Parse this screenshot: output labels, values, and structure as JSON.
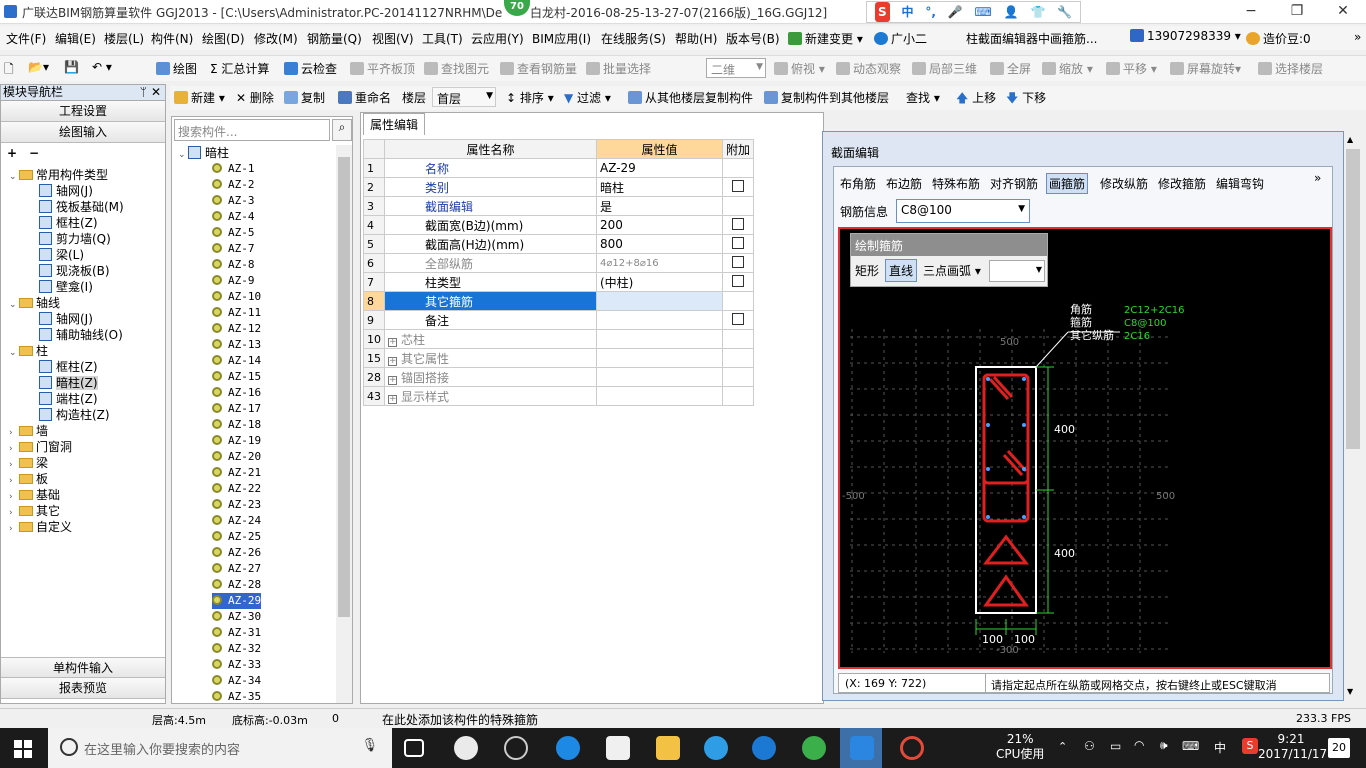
{
  "window": {
    "title": "广联达BIM钢筋算量软件 GGJ2013 - [C:\\Users\\Administrator.PC-20141127NRHM\\De",
    "title_tail": "白龙村-2016-08-25-13-27-07(2166版)_16G.GGJ12]",
    "badge": "70",
    "minimize": "−",
    "restore": "❐",
    "close": "✕"
  },
  "ime": {
    "s": "S",
    "zh": "中",
    "dot": "°,",
    "mic": "🎤",
    "kb": "⌨",
    "user": "👤",
    "shirt": "👕",
    "tool": "🔧"
  },
  "menu": [
    "文件(F)",
    "编辑(E)",
    "楼层(L)",
    "构件(N)",
    "绘图(D)",
    "修改(M)",
    "钢筋量(Q)",
    "视图(V)",
    "工具(T)",
    "云应用(Y)",
    "BIM应用(I)",
    "在线服务(S)",
    "帮助(H)",
    "版本号(B)",
    "新建变更",
    "广小二",
    "柱截面编辑器中画箍筋..."
  ],
  "phone": "13907298339",
  "price": "造价豆:0",
  "toolbar1": {
    "draw": "绘图",
    "sum": "汇总计算",
    "cloud": "云检查",
    "flat": "平齐板顶",
    "find_elem": "查找图元",
    "view_qty": "查看钢筋量",
    "batch": "批量选择",
    "view_mode": "二维",
    "top_view": "俯视",
    "dyn": "动态观察",
    "local3d": "局部三维",
    "fullscreen": "全屏",
    "zoom": "缩放",
    "pan": "平移",
    "rotate": "屏幕旋转",
    "select_floor": "选择楼层"
  },
  "toolbar2": {
    "new": "新建",
    "delete": "删除",
    "copy": "复制",
    "rename": "重命名",
    "floor_label": "楼层",
    "floor_value": "首层",
    "sort": "排序",
    "filter": "过滤",
    "copy_from": "从其他楼层复制构件",
    "copy_to": "复制构件到其他楼层",
    "find": "查找",
    "up": "上移",
    "down": "下移"
  },
  "nav": {
    "header": "模块导航栏",
    "pin": "ᛘ",
    "close": "✕",
    "btn1": "工程设置",
    "btn2": "绘图输入",
    "btn3": "单构件输入",
    "btn4": "报表预览",
    "tree": [
      {
        "lvl": 0,
        "exp": "⌄",
        "kind": "folder",
        "label": "常用构件类型"
      },
      {
        "lvl": 1,
        "kind": "comp",
        "label": "轴网(J)"
      },
      {
        "lvl": 1,
        "kind": "comp",
        "label": "筏板基础(M)"
      },
      {
        "lvl": 1,
        "kind": "comp",
        "label": "框柱(Z)"
      },
      {
        "lvl": 1,
        "kind": "comp",
        "label": "剪力墙(Q)"
      },
      {
        "lvl": 1,
        "kind": "comp",
        "label": "梁(L)"
      },
      {
        "lvl": 1,
        "kind": "comp",
        "label": "现浇板(B)"
      },
      {
        "lvl": 1,
        "kind": "comp",
        "label": "壁龛(I)"
      },
      {
        "lvl": 0,
        "exp": "⌄",
        "kind": "folder",
        "label": "轴线"
      },
      {
        "lvl": 1,
        "kind": "comp",
        "label": "轴网(J)"
      },
      {
        "lvl": 1,
        "kind": "comp",
        "label": "辅助轴线(O)"
      },
      {
        "lvl": 0,
        "exp": "⌄",
        "kind": "folder",
        "label": "柱"
      },
      {
        "lvl": 1,
        "kind": "comp",
        "label": "框柱(Z)"
      },
      {
        "lvl": 1,
        "kind": "comp",
        "label": "暗柱(Z)",
        "selected": true
      },
      {
        "lvl": 1,
        "kind": "comp",
        "label": "端柱(Z)"
      },
      {
        "lvl": 1,
        "kind": "comp",
        "label": "构造柱(Z)"
      },
      {
        "lvl": 0,
        "exp": "›",
        "kind": "folder",
        "label": "墙"
      },
      {
        "lvl": 0,
        "exp": "›",
        "kind": "folder",
        "label": "门窗洞"
      },
      {
        "lvl": 0,
        "exp": "›",
        "kind": "folder",
        "label": "梁"
      },
      {
        "lvl": 0,
        "exp": "›",
        "kind": "folder",
        "label": "板"
      },
      {
        "lvl": 0,
        "exp": "›",
        "kind": "folder",
        "label": "基础"
      },
      {
        "lvl": 0,
        "exp": "›",
        "kind": "folder",
        "label": "其它"
      },
      {
        "lvl": 0,
        "exp": "›",
        "kind": "folder",
        "label": "自定义"
      }
    ]
  },
  "complist": {
    "search_placeholder": "搜索构件...",
    "root": "暗柱",
    "items": [
      "AZ-1",
      "AZ-2",
      "AZ-3",
      "AZ-4",
      "AZ-5",
      "AZ-7",
      "AZ-8",
      "AZ-9",
      "AZ-10",
      "AZ-11",
      "AZ-12",
      "AZ-13",
      "AZ-14",
      "AZ-15",
      "AZ-16",
      "AZ-17",
      "AZ-18",
      "AZ-19",
      "AZ-20",
      "AZ-21",
      "AZ-22",
      "AZ-23",
      "AZ-24",
      "AZ-25",
      "AZ-26",
      "AZ-27",
      "AZ-28",
      "AZ-29",
      "AZ-30",
      "AZ-31",
      "AZ-32",
      "AZ-33",
      "AZ-34",
      "AZ-35"
    ],
    "selected": "AZ-29"
  },
  "props": {
    "tab": "属性编辑",
    "col_name": "属性名称",
    "col_value": "属性值",
    "col_extra": "附加",
    "rows": [
      {
        "n": "1",
        "name": "名称",
        "value": "AZ-29",
        "style": "blue",
        "check": false
      },
      {
        "n": "2",
        "name": "类别",
        "value": "暗柱",
        "style": "blue",
        "check": true
      },
      {
        "n": "3",
        "name": "截面编辑",
        "value": "是",
        "style": "blue",
        "check": false
      },
      {
        "n": "4",
        "name": "截面宽(B边)(mm)",
        "value": "200",
        "style": "",
        "check": true
      },
      {
        "n": "5",
        "name": "截面高(H边)(mm)",
        "value": "800",
        "style": "",
        "check": true
      },
      {
        "n": "6",
        "name": "全部纵筋",
        "value": "4⌀12+8⌀16",
        "style": "gray",
        "check": true
      },
      {
        "n": "7",
        "name": "柱类型",
        "value": "(中柱)",
        "style": "",
        "check": true
      },
      {
        "n": "8",
        "name": "其它箍筋",
        "value": "",
        "style": "sel",
        "check": false
      },
      {
        "n": "9",
        "name": "备注",
        "value": "",
        "style": "",
        "check": true
      },
      {
        "n": "10",
        "name": "芯柱",
        "value": "",
        "style": "group",
        "check": false
      },
      {
        "n": "15",
        "name": "其它属性",
        "value": "",
        "style": "group",
        "check": false
      },
      {
        "n": "28",
        "name": "锚固搭接",
        "value": "",
        "style": "group",
        "check": false
      },
      {
        "n": "43",
        "name": "显示样式",
        "value": "",
        "style": "group",
        "check": false
      }
    ]
  },
  "section": {
    "title": "截面编辑",
    "tabs": [
      "布角筋",
      "布边筋",
      "特殊布筋",
      "对齐钢筋",
      "画箍筋",
      "修改纵筋",
      "修改箍筋",
      "编辑弯钩"
    ],
    "active_tab": "画箍筋",
    "more": "»",
    "rebar_label": "钢筋信息",
    "rebar_value": "C8@100",
    "draw_title": "绘制箍筋",
    "draw_rect": "矩形",
    "draw_line": "直线",
    "draw_arc": "三点画弧",
    "legend": {
      "corner_label": "角筋",
      "corner_value": "2C12+2C16",
      "stirrup_label": "箍筋",
      "stirrup_value": "C8@100",
      "other_label": "其它纵筋",
      "other_value": "2C16"
    },
    "dims": {
      "top": "500",
      "left": "-500",
      "right": "500",
      "bottom": "-300",
      "seg1": "400",
      "seg2": "400",
      "w1": "100",
      "w2": "100"
    },
    "coords": "(X: 169 Y: 722)",
    "hint": "请指定起点所在纵筋或网格交点，按右键终止或ESC键取消"
  },
  "status": {
    "floor_h": "层高:4.5m",
    "base_h": "底标高:-0.03m",
    "zero": "0",
    "msg": "在此处添加该构件的特殊箍筋",
    "fps": "233.3 FPS"
  },
  "taskbar": {
    "search": "在这里输入你要搜索的内容",
    "cpu": "21%",
    "cpu_label": "CPU使用",
    "ime": "中",
    "time": "9:21",
    "date": "2017/11/17",
    "notif": "20"
  },
  "colors": {
    "accent": "#1874d6",
    "rebar": "#e02020",
    "dim": "#2ed62e",
    "legend": "#2ed62e"
  }
}
